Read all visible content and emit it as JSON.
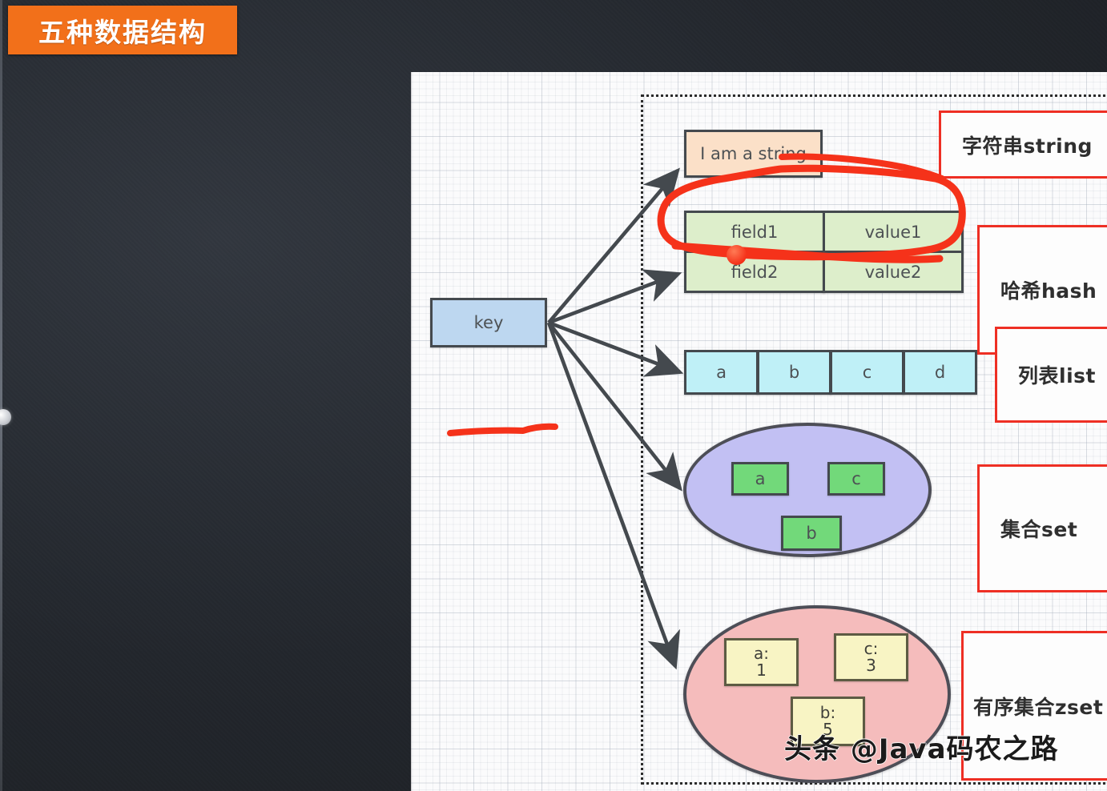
{
  "banner": {
    "title": "五种数据结构"
  },
  "diagram": {
    "key_node": {
      "label": "key"
    },
    "string": {
      "label": "I am a string"
    },
    "hash": {
      "rows": [
        {
          "field": "field1",
          "value": "value1"
        },
        {
          "field": "field2",
          "value": "value2"
        }
      ]
    },
    "list": {
      "items": [
        "a",
        "b",
        "c",
        "d"
      ]
    },
    "set": {
      "items": [
        "a",
        "c",
        "b"
      ]
    },
    "zset": {
      "items": [
        {
          "member": "a:",
          "score": "1"
        },
        {
          "member": "c:",
          "score": "3"
        },
        {
          "member": "b:",
          "score": "5"
        }
      ]
    },
    "labels": [
      {
        "text": "字符串string"
      },
      {
        "text": "哈希hash"
      },
      {
        "text": "列表list"
      },
      {
        "text": "集合set"
      },
      {
        "text": "有序集合zset"
      }
    ]
  },
  "annotations": {
    "ink_color": "#f5321a",
    "cursor_color": "#f5321a"
  },
  "watermark": {
    "text": "头条 @Java码农之路"
  },
  "colors": {
    "banner_bg": "#f2701a",
    "key_fill": "#bdd7f0",
    "string_fill": "#fbe0c8",
    "hash_fill": "#ddeecb",
    "list_fill": "#bff0f7",
    "set_fill": "#c2c0f3",
    "set_item_fill": "#72d97a",
    "zset_fill": "#f5bcbc",
    "zset_item_fill": "#f8f4c4",
    "label_border": "#ee2f24",
    "node_border": "#44494e",
    "canvas_bg": "#fbfbfc",
    "backdrop": "#262a30"
  }
}
